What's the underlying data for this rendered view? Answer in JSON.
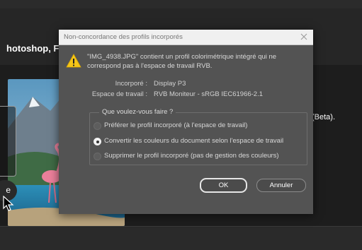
{
  "background": {
    "app_title": "hotoshop, F",
    "side_text": "(Beta).",
    "button_letter": "e"
  },
  "dialog": {
    "title": "Non-concordance des profils incorporés",
    "message": "\"IMG_4938.JPG\" contient un profil colorimétrique intégré qui ne correspond pas à l'espace de travail RVB.",
    "embedded_label": "Incorporé :",
    "embedded_value": "Display P3",
    "working_space_label": "Espace de travail :",
    "working_space_value": "RVB Moniteur - sRGB IEC61966-2.1",
    "question": "Que voulez-vous faire ?",
    "options": [
      {
        "label": "Préférer le profil incorporé (à l'espace de travail)",
        "selected": false
      },
      {
        "label": "Convertir les couleurs du document selon l'espace de travail",
        "selected": true
      },
      {
        "label": "Supprimer le profil incorporé (pas de gestion des couleurs)",
        "selected": false
      }
    ],
    "ok_label": "OK",
    "cancel_label": "Annuler"
  },
  "colors": {
    "dialog_bg": "#535353",
    "titlebar_bg": "#f0f0f0",
    "warning": "#f5c518"
  }
}
